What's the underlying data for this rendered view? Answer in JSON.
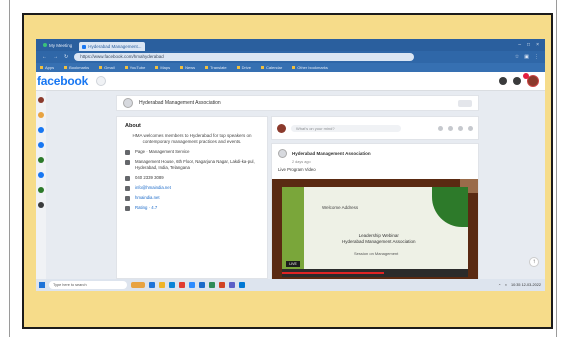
{
  "browser": {
    "tabs": [
      {
        "label": "My Meeting"
      },
      {
        "label": "Hyderabad Management..."
      }
    ],
    "url": "https://www.facebook.com/hmahyderabad",
    "bookmarks": [
      "Apps",
      "Bookmarks",
      "Gmail",
      "YouTube",
      "Maps",
      "News",
      "Translate",
      "Drive",
      "Calendar",
      "Other bookmarks"
    ]
  },
  "facebook": {
    "logo": "facebook",
    "page_name": "Hyderabad Management Association",
    "about": {
      "title": "About",
      "intro": "HMA welcomes members to Hyderabad for top speakers on contemporary management practices and events.",
      "rows": [
        {
          "icon": "page-icon",
          "text": "Page · Management Service"
        },
        {
          "icon": "location-icon",
          "text": "Management House, 6th Floor, Nagarjuna Nagar, Lakdi-ka-pul, Hyderabad, India, Telangana"
        },
        {
          "icon": "phone-icon",
          "text": "040 2339 3089"
        },
        {
          "icon": "email-icon",
          "text": "info@hmaindia.net"
        },
        {
          "icon": "link-icon",
          "text": "hmaindia.net"
        },
        {
          "icon": "rating-icon",
          "text": "Rating · 4.7"
        }
      ]
    },
    "create_post": {
      "placeholder": "What's on your mind?"
    },
    "post": {
      "author": "Hyderabad Management Association",
      "date": "2 days ago",
      "text": "Live Program Video",
      "slide": {
        "title": "Welcome Address",
        "main_line_1": "Leadership Webinar",
        "main_line_2": "Hyderabad Management Association",
        "sub": "Session on Management",
        "video_button": "LIVE",
        "progress": 0.55
      }
    }
  },
  "taskbar": {
    "search_placeholder": "Type here to search",
    "tray_time": "10:35",
    "tray_date": "12-03-2022"
  },
  "colors": {
    "frame_bg": "#f6dc8a",
    "browser_chrome": "#2a5f9e",
    "facebook_blue": "#1877f2"
  }
}
